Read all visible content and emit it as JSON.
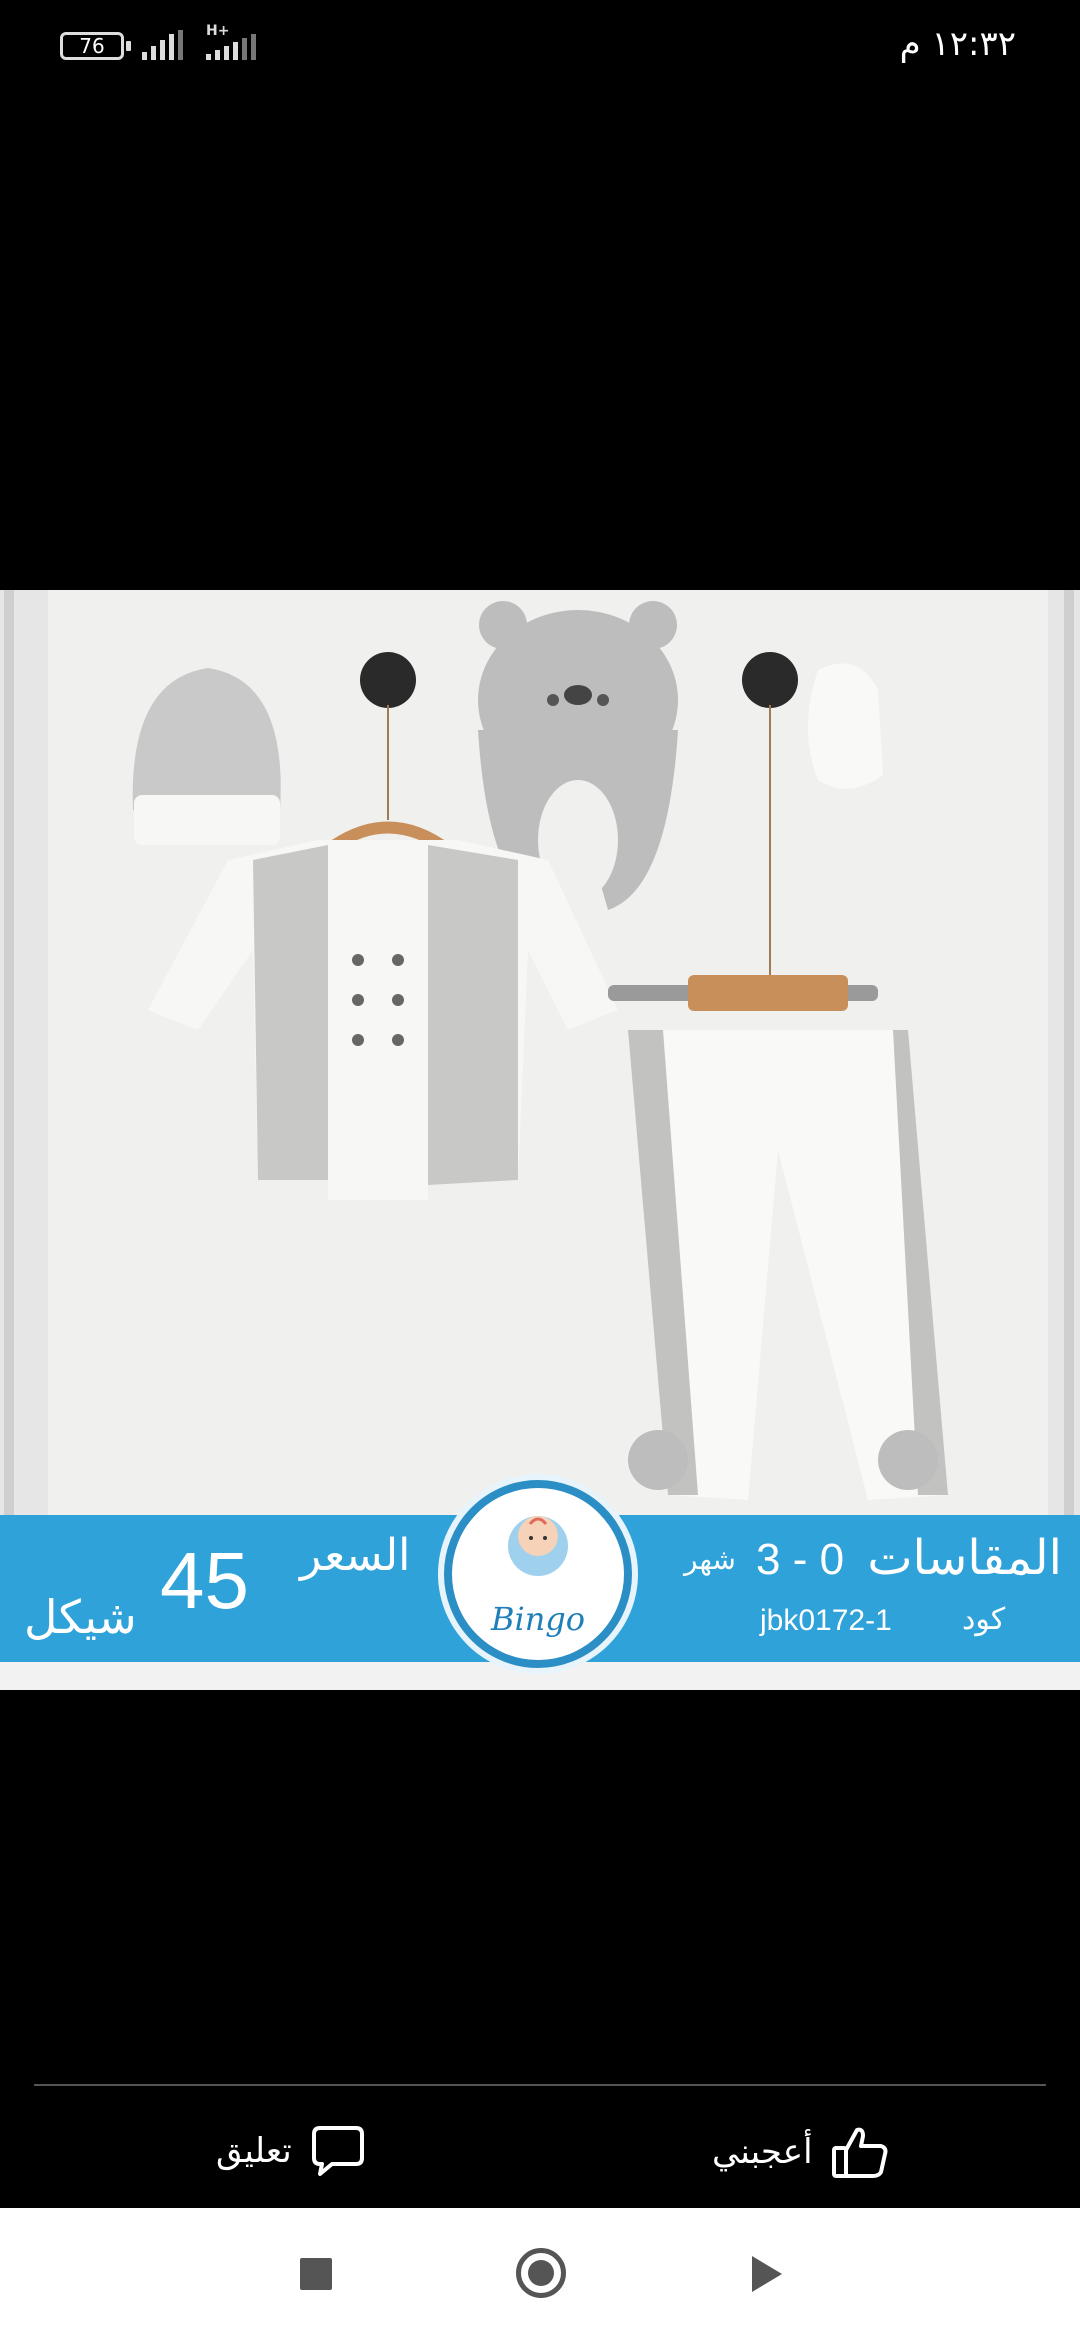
{
  "status_bar": {
    "battery": "76",
    "network_type": "H+",
    "time": "١٢:٣٢ م"
  },
  "post": {
    "image_description_icon": "baby-clothes-set-photo",
    "banner": {
      "sizes_label": "المقاسات",
      "sizes_value": "3 - 0",
      "sizes_unit": "شهر",
      "code_label": "كود",
      "code_value": "jbk0172-1",
      "price_label": "السعر",
      "price_value": "45",
      "currency": "شيكل",
      "logo_text": "Bingo"
    }
  },
  "actions": {
    "like_label": "أعجبني",
    "comment_label": "تعليق"
  },
  "colors": {
    "banner": "#2ea2d9",
    "logo_ring": "#2b8fc6",
    "background": "#000000"
  }
}
